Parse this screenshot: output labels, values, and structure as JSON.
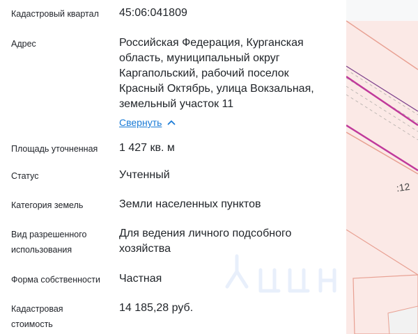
{
  "fields": [
    {
      "label": "Кадастровый квартал",
      "value": "45:06:041809"
    },
    {
      "label": "Адрес",
      "value": "Российская Федерация, Курганская область, муниципальный округ Каргапольский, рабочий поселок Красный Октябрь, улица Вокзальная, земельный участок 11"
    },
    {
      "label": "Площадь уточненная",
      "value": "1 427 кв. м"
    },
    {
      "label": "Статус",
      "value": "Учтенный"
    },
    {
      "label": "Категория земель",
      "value": "Земли населенных пунктов"
    },
    {
      "label": "Вид разрешенного использования",
      "value": "Для ведения личного подсобного хозяйства"
    },
    {
      "label": "Форма собственности",
      "value": "Частная"
    },
    {
      "label": "Кадастровая стоимость",
      "value": "14 185,28 руб."
    }
  ],
  "address_toggle": {
    "label": "Свернуть",
    "icon": "chevron-up-icon"
  },
  "map": {
    "parcel_label": ":12"
  },
  "colors": {
    "link": "#1a7bd6",
    "parcel_fill": "#fbe9e6",
    "parcel_border": "#e8a092",
    "line_magenta": "#c0399b"
  }
}
